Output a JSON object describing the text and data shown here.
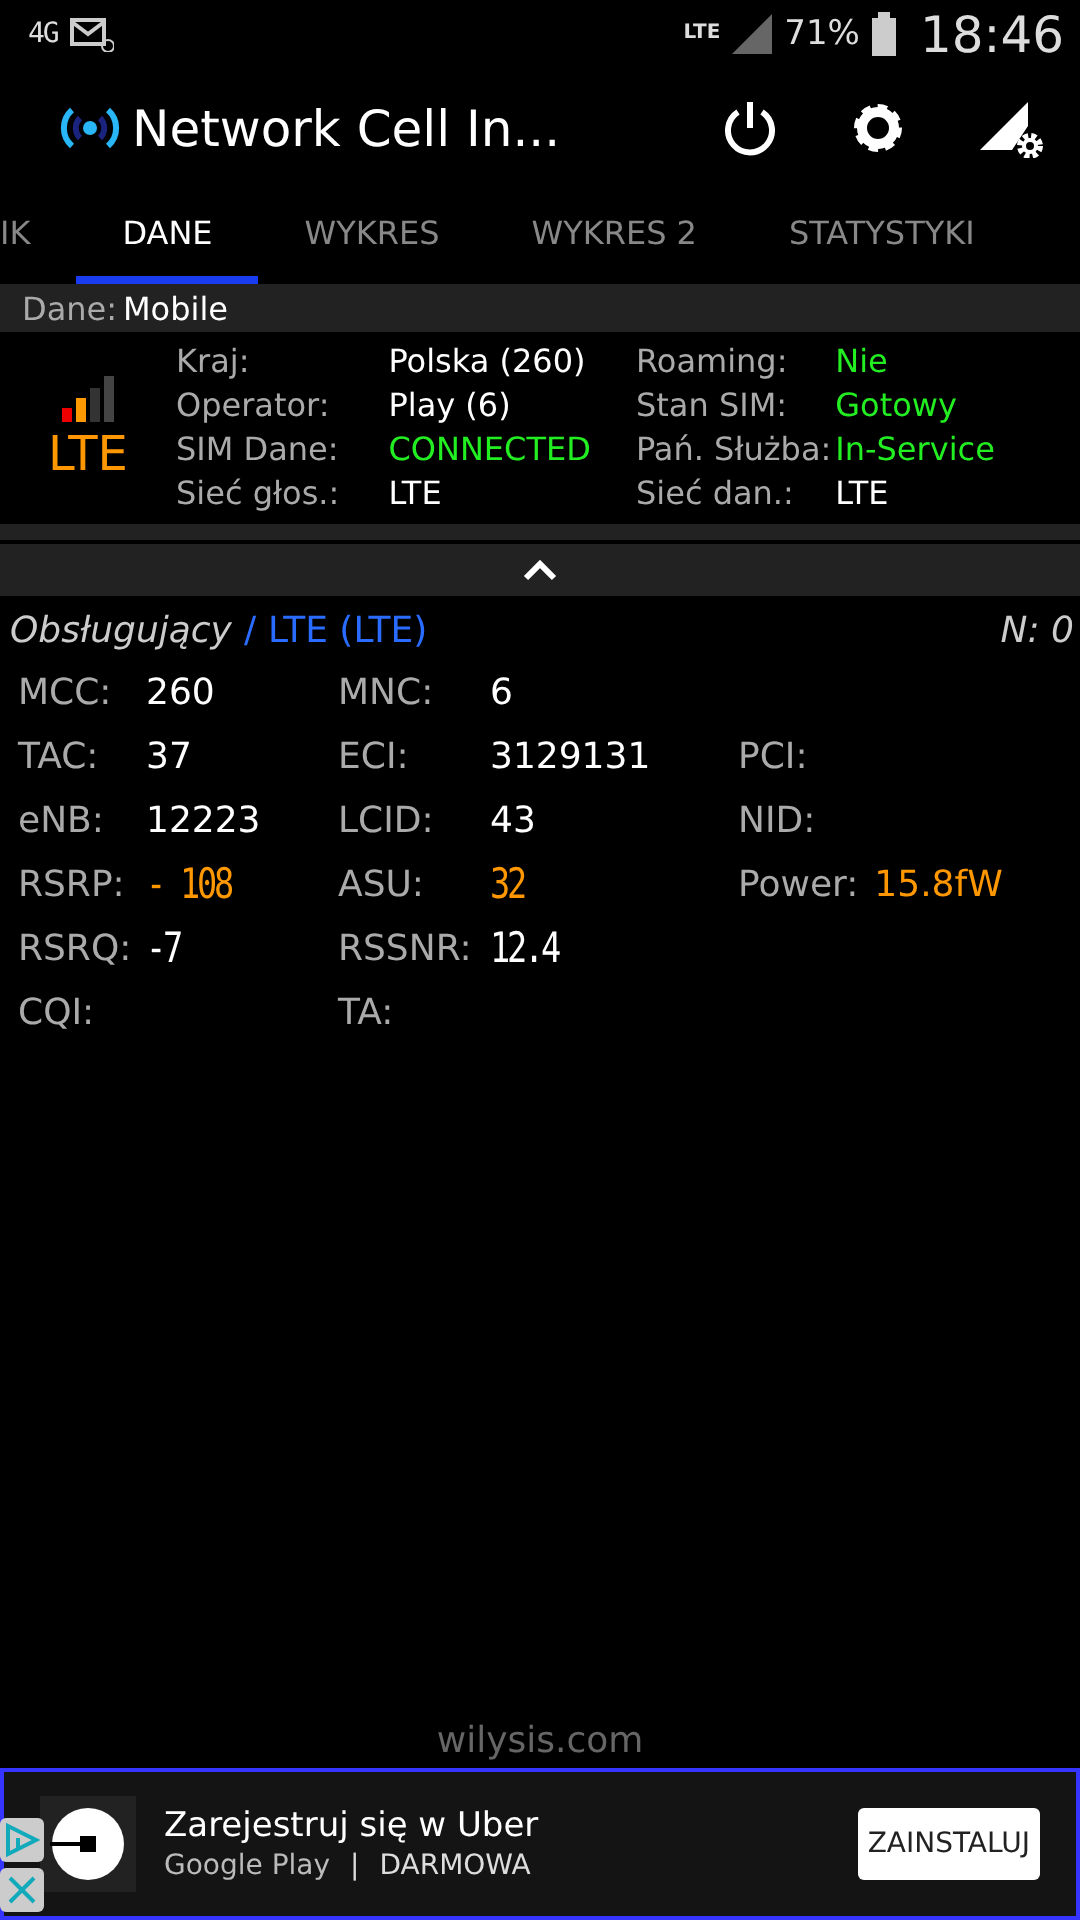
{
  "status_bar": {
    "network": "4G",
    "data_type": "LTE",
    "battery": "71%",
    "time": "18:46"
  },
  "app_bar": {
    "title": "Network Cell In..."
  },
  "tabs": [
    {
      "label": "IK",
      "selected": false
    },
    {
      "label": "DANE",
      "selected": true
    },
    {
      "label": "WYKRES",
      "selected": false
    },
    {
      "label": "WYKRES 2",
      "selected": false
    },
    {
      "label": "STATYSTYKI",
      "selected": false
    }
  ],
  "data_bar": {
    "label": "Dane:",
    "value": "Mobile"
  },
  "summary": {
    "network_type": "LTE",
    "left": [
      {
        "label": "Kraj:",
        "value": "Polska (260)",
        "positive": false
      },
      {
        "label": "Operator:",
        "value": "Play (6)",
        "positive": false
      },
      {
        "label": "SIM Dane:",
        "value": "CONNECTED",
        "positive": true
      },
      {
        "label": "Sieć głos.:",
        "value": "LTE",
        "positive": false
      }
    ],
    "right": [
      {
        "label": "Roaming:",
        "value": "Nie",
        "positive": true
      },
      {
        "label": "Stan SIM:",
        "value": "Gotowy",
        "positive": true
      },
      {
        "label": "Pań. Służba:",
        "value": "In-Service",
        "positive": true
      },
      {
        "label": "Sieć dan.:",
        "value": "LTE",
        "positive": false
      }
    ]
  },
  "serving": {
    "title": "Obsługujący",
    "separator": "/",
    "technology": "LTE (LTE)",
    "neighbors": "N: 0"
  },
  "cell_rows": [
    [
      {
        "label": "MCC:",
        "value": "260",
        "kind": "plain",
        "highlight": false
      },
      {
        "label": "MNC:",
        "value": "6",
        "kind": "plain",
        "highlight": false
      }
    ],
    [
      {
        "label": "TAC:",
        "value": "37",
        "kind": "plain",
        "highlight": false
      },
      {
        "label": "ECI:",
        "value": "3129131",
        "kind": "plain",
        "highlight": false
      },
      {
        "label": "PCI:"
      }
    ],
    [
      {
        "label": "eNB:",
        "value": "12223",
        "kind": "plain",
        "highlight": false
      },
      {
        "label": "LCID:",
        "value": "43",
        "kind": "plain",
        "highlight": false
      },
      {
        "label": "NID:"
      }
    ],
    [
      {
        "label": "RSRP:",
        "value": "- 108",
        "kind": "digital",
        "highlight": true
      },
      {
        "label": "ASU:",
        "value": "32",
        "kind": "digital",
        "highlight": true
      },
      {
        "label": "Power:",
        "value": "15.8fW",
        "kind": "plain",
        "highlight": true
      }
    ],
    [
      {
        "label": "RSRQ:",
        "value": "-7",
        "kind": "digital",
        "highlight": false
      },
      {
        "label": "RSSNR:",
        "value": "12.4",
        "kind": "digital",
        "highlight": false
      }
    ],
    [
      {
        "label": "CQI:"
      },
      {
        "label": "TA:"
      }
    ]
  ],
  "footer": "wilysis.com",
  "ad": {
    "title": "Zarejestruj się w Uber",
    "store": "Google Play",
    "separator": "|",
    "price": "DARMOWA",
    "button": "ZAINSTALUJ"
  }
}
